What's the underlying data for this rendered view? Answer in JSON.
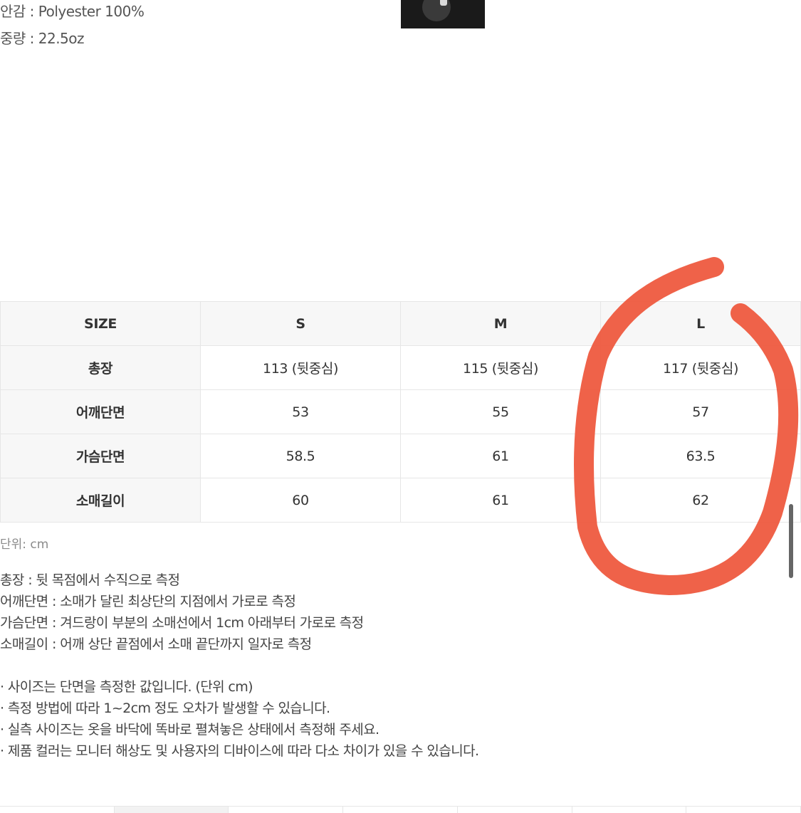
{
  "specs": {
    "lining": "안감 : Polyester 100%",
    "weight": "중량 : 22.5oz"
  },
  "size_table": {
    "header": [
      "SIZE",
      "S",
      "M",
      "L"
    ],
    "rows": [
      {
        "label": "총장",
        "values": [
          "113 (뒷중심)",
          "115 (뒷중심)",
          "117 (뒷중심)"
        ]
      },
      {
        "label": "어깨단면",
        "values": [
          "53",
          "55",
          "57"
        ]
      },
      {
        "label": "가슴단면",
        "values": [
          "58.5",
          "61",
          "63.5"
        ]
      },
      {
        "label": "소매길이",
        "values": [
          "60",
          "61",
          "62"
        ]
      }
    ]
  },
  "unit_label": "단위: cm",
  "measurement_notes": [
    "총장 : 뒷 목점에서 수직으로 측정",
    "어깨단면 : 소매가 달린 최상단의 지점에서 가로로 측정",
    "가슴단면 : 겨드랑이 부분의 소매선에서 1cm 아래부터 가로로 측정",
    "소매길이 : 어깨 상단 끝점에서 소매 끝단까지 일자로 측정"
  ],
  "disclaimers": [
    "· 사이즈는 단면을 측정한 값입니다. (단위 cm)",
    "· 측정 방법에 따라 1~2cm 정도 오차가 발생할 수 있습니다.",
    "· 실측 사이즈는 옷을 바닥에 똑바로 펼쳐놓은 상태에서 측정해 주세요.",
    "· 제품 컬러는 모니터 해상도 및 사용자의 디바이스에 따라 다소 차이가 있을 수 있습니다."
  ],
  "annotation": {
    "color": "#ee5a3f"
  }
}
